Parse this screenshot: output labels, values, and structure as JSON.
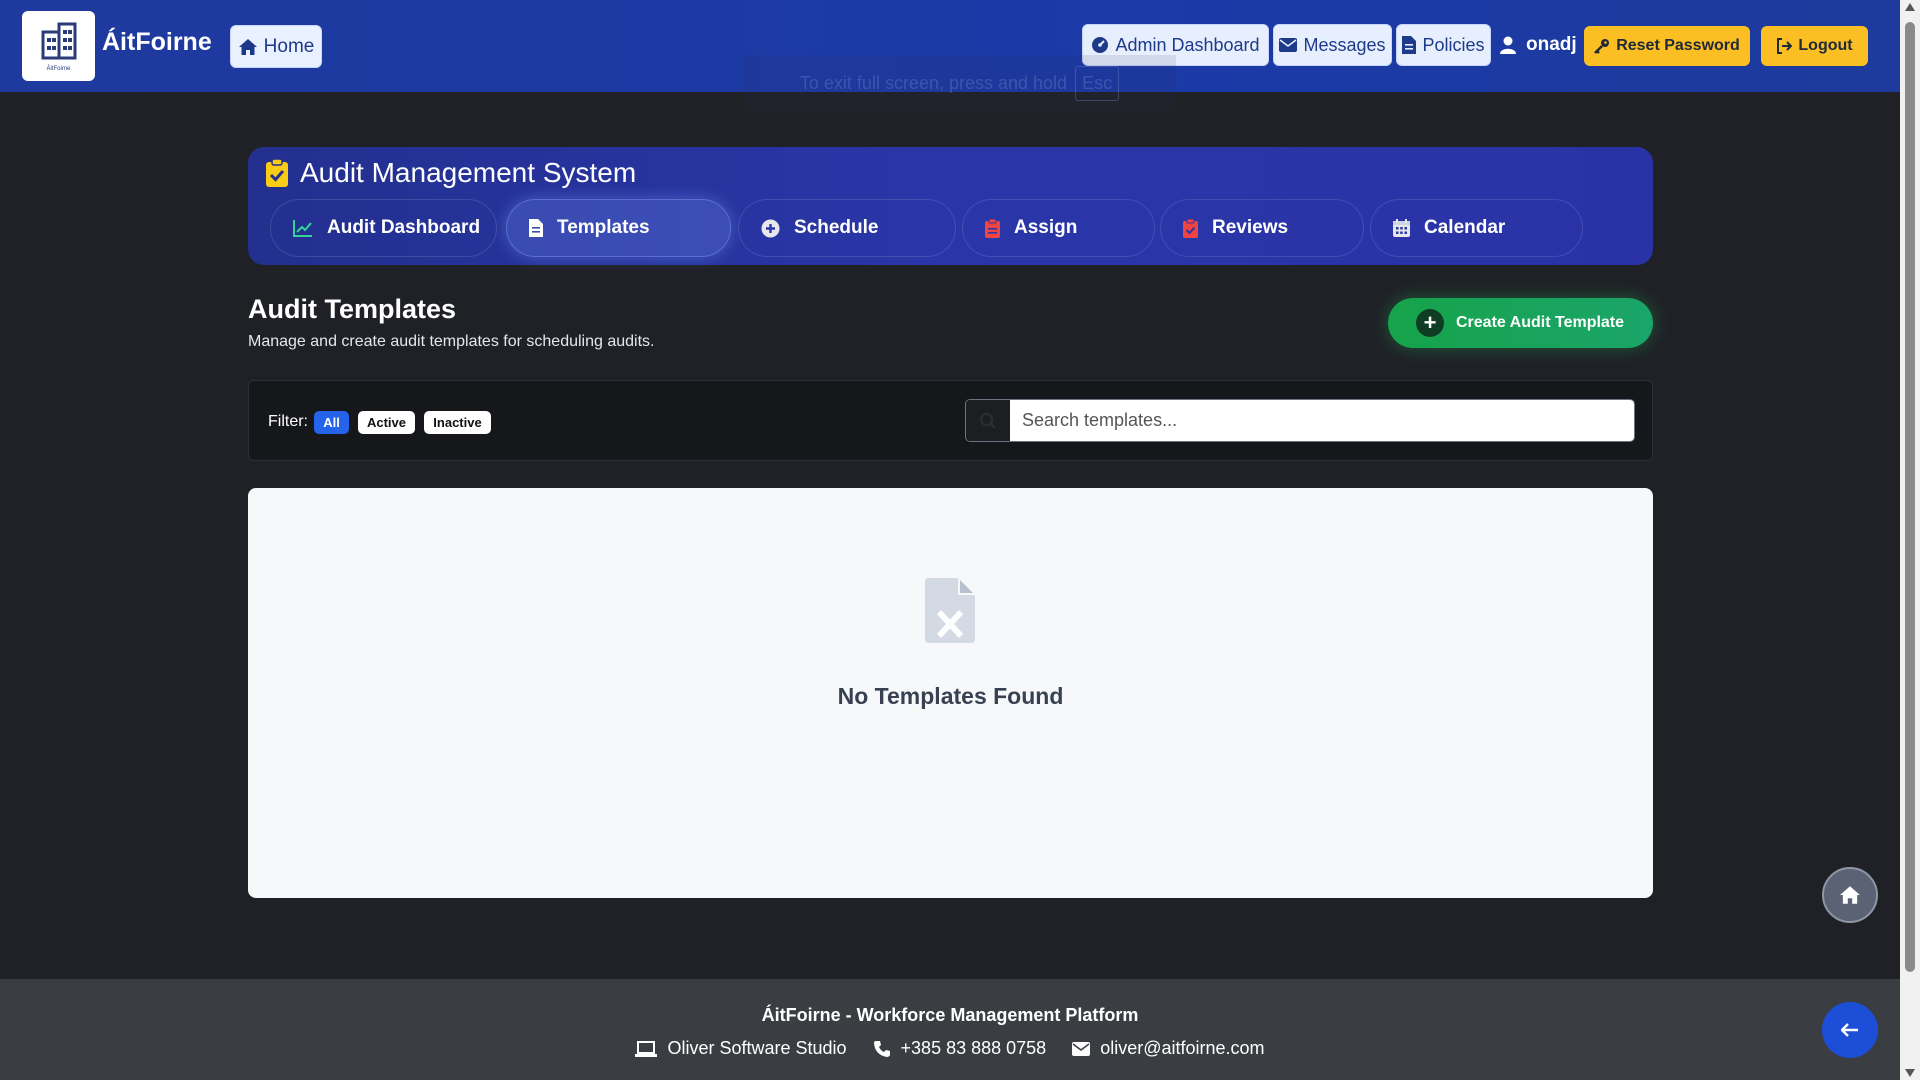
{
  "app": {
    "brand": "ÁitFoirne",
    "logo_small_text": "ÁitFoirne"
  },
  "nav": {
    "home": "Home",
    "admin_dashboard": "Admin Dashboard",
    "messages": "Messages",
    "policies": "Policies",
    "username": "onadj",
    "reset_password": "Reset Password",
    "logout": "Logout"
  },
  "fullscreen_hint": {
    "text": "To exit full screen, press and hold",
    "key": "Esc"
  },
  "audit": {
    "title": "Audit Management System",
    "tabs": [
      {
        "label": "Audit Dashboard",
        "icon": "chart-line-icon"
      },
      {
        "label": "Templates",
        "icon": "file-icon",
        "active": true
      },
      {
        "label": "Schedule",
        "icon": "plus-circle-icon"
      },
      {
        "label": "Assign",
        "icon": "clipboard-icon"
      },
      {
        "label": "Reviews",
        "icon": "clipboard-check-icon"
      },
      {
        "label": "Calendar",
        "icon": "calendar-icon"
      }
    ]
  },
  "page": {
    "title": "Audit Templates",
    "subtitle": "Manage and create audit templates for scheduling audits.",
    "create_button": "Create Audit Template"
  },
  "filter": {
    "label": "Filter:",
    "options": [
      "All",
      "Active",
      "Inactive"
    ],
    "selected": "All",
    "search_placeholder": "Search templates..."
  },
  "empty_state": {
    "message": "No Templates Found"
  },
  "footer": {
    "title": "ÁitFoirne - Workforce Management Platform",
    "company": "Oliver Software Studio",
    "phone": "+385 83 888 0758",
    "email": "oliver@aitfoirne.com"
  },
  "colors": {
    "accent": "#1e3a9e",
    "success": "#16a34a",
    "warning": "#fbbf24",
    "primary": "#2563eb"
  }
}
